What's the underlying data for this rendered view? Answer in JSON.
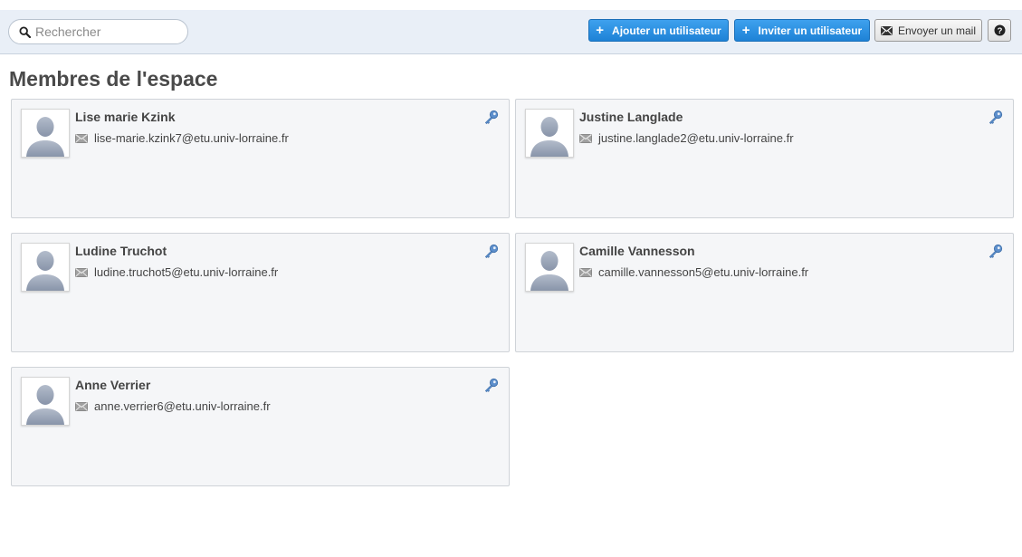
{
  "search": {
    "placeholder": "Rechercher",
    "value": ""
  },
  "toolbar": {
    "add_user_label": "Ajouter un utilisateur",
    "invite_user_label": "Inviter un utilisateur",
    "send_mail_label": "Envoyer un mail",
    "help_label": "?"
  },
  "page": {
    "title": "Membres de l'espace"
  },
  "members": [
    {
      "name": "Lise marie Kzink",
      "email": "lise-marie.kzink7@etu.univ-lorraine.fr"
    },
    {
      "name": "Justine Langlade",
      "email": "justine.langlade2@etu.univ-lorraine.fr"
    },
    {
      "name": "Ludine Truchot",
      "email": "ludine.truchot5@etu.univ-lorraine.fr"
    },
    {
      "name": "Camille Vannesson",
      "email": "camille.vannesson5@etu.univ-lorraine.fr"
    },
    {
      "name": "Anne Verrier",
      "email": "anne.verrier6@etu.univ-lorraine.fr"
    }
  ],
  "icons": {
    "search": "search-icon",
    "add": "plus-icon",
    "mail": "envelope-icon",
    "help": "help-icon",
    "avatar": "user-silhouette-icon",
    "edit": "key-icon"
  },
  "colors": {
    "toolbar_bg": "#e9eff7",
    "primary_button": "#1e82d6",
    "card_bg": "#f5f6f8",
    "card_border": "#cfd3d8",
    "key_icon": "#4a7fc0"
  }
}
